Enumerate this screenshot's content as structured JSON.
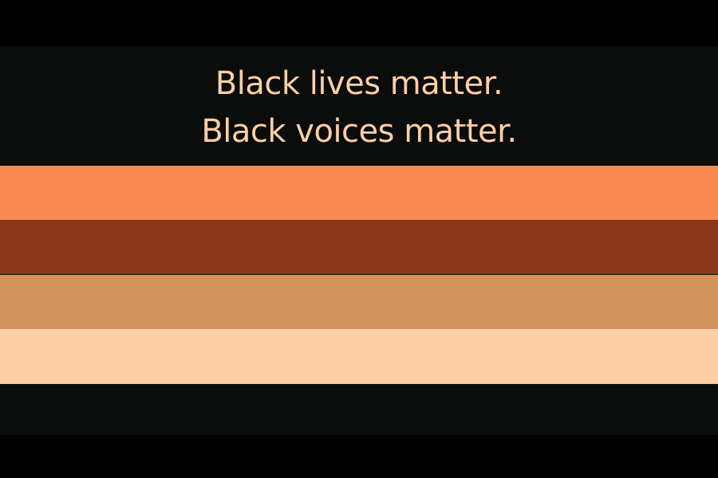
{
  "headline": {
    "lines": [
      "Black lives matter.",
      "Black voices matter."
    ],
    "color": "#fdcfa5"
  },
  "colors": {
    "outer_background": "#000000",
    "banner_background": "#0b0c0c"
  },
  "stripes": [
    {
      "name": "light-orange",
      "color": "#fb8c51"
    },
    {
      "name": "rust-brown",
      "color": "#8a3619"
    },
    {
      "name": "tan",
      "color": "#d0935c"
    },
    {
      "name": "peach",
      "color": "#fdcfa5"
    }
  ]
}
